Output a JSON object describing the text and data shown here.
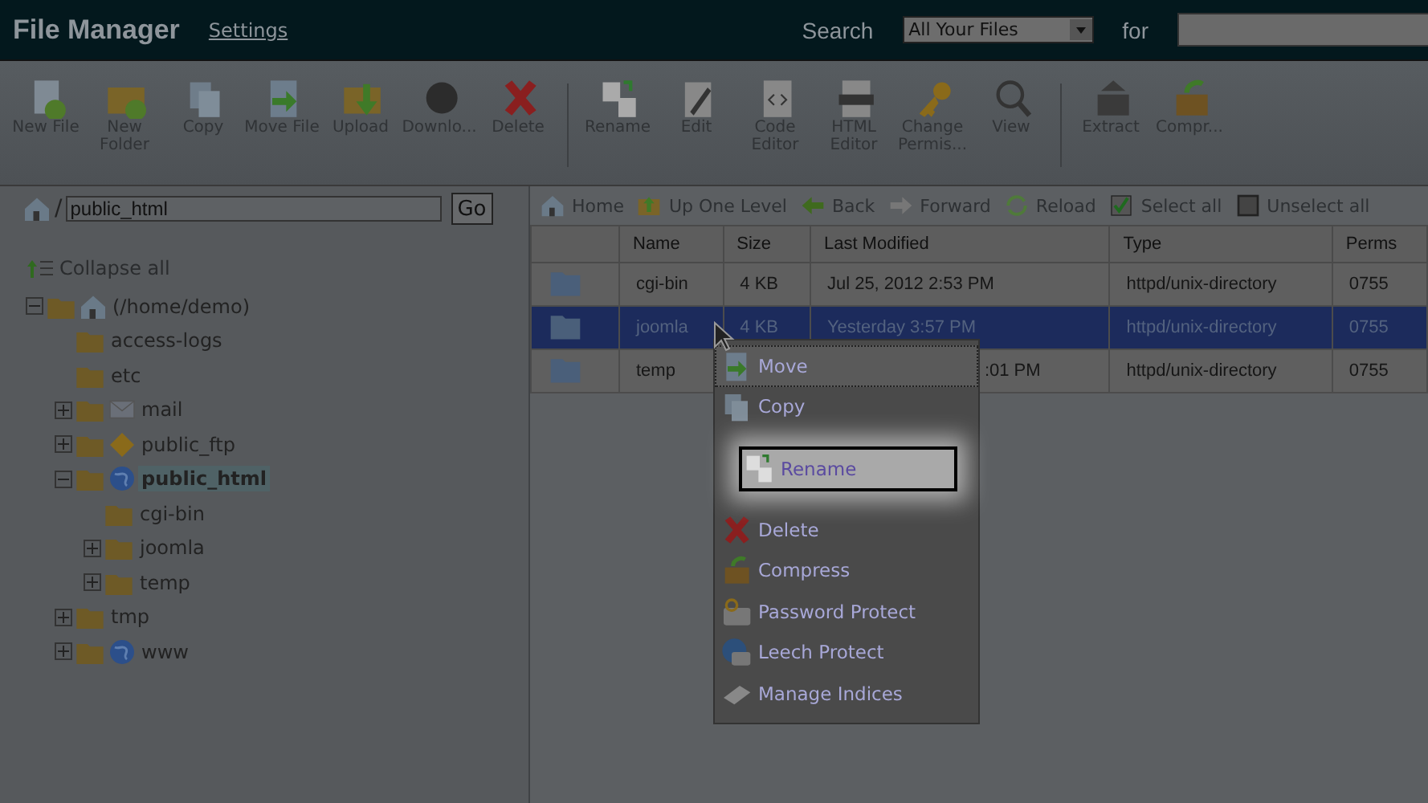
{
  "header": {
    "title": "File Manager",
    "settings_link": "Settings",
    "search_label": "Search",
    "search_scope": "All Your Files",
    "for_label": "for"
  },
  "toolbar": [
    [
      {
        "label": "New File",
        "kind": "newfile"
      },
      {
        "label": "New Folder",
        "kind": "newfolder"
      },
      {
        "label": "Copy",
        "kind": "copy"
      },
      {
        "label": "Move File",
        "kind": "move"
      },
      {
        "label": "Upload",
        "kind": "upload"
      },
      {
        "label": "Downlo...",
        "kind": "download"
      },
      {
        "label": "Delete",
        "kind": "delete"
      }
    ],
    [
      {
        "label": "Rename",
        "kind": "rename"
      },
      {
        "label": "Edit",
        "kind": "edit"
      },
      {
        "label": "Code Editor",
        "kind": "code"
      },
      {
        "label": "HTML Editor",
        "kind": "html"
      },
      {
        "label": "Change Permis...",
        "kind": "key"
      },
      {
        "label": "View",
        "kind": "view"
      }
    ],
    [
      {
        "label": "Extract",
        "kind": "extract"
      },
      {
        "label": "Compr...",
        "kind": "compress"
      }
    ]
  ],
  "path_bar": {
    "prefix": "/",
    "value": "public_html",
    "button": "Go"
  },
  "collapse_all": "Collapse all",
  "tree": [
    {
      "label": "(/home/demo)",
      "kind": "home",
      "expanded": true,
      "selected": false,
      "children": [
        {
          "label": "access-logs",
          "selected": false
        },
        {
          "label": "etc",
          "selected": false
        },
        {
          "label": "mail",
          "kind": "mail",
          "expanded": false,
          "selected": false
        },
        {
          "label": "public_ftp",
          "kind": "ftp",
          "expanded": false,
          "selected": false
        },
        {
          "label": "public_html",
          "kind": "globe",
          "expanded": true,
          "selected": true,
          "children": [
            {
              "label": "cgi-bin",
              "selected": false
            },
            {
              "label": "joomla",
              "expanded": false,
              "selected": false
            },
            {
              "label": "temp",
              "expanded": false,
              "selected": false
            }
          ]
        },
        {
          "label": "tmp",
          "expanded": false,
          "selected": false
        },
        {
          "label": "www",
          "kind": "globe",
          "expanded": false,
          "selected": false
        }
      ]
    }
  ],
  "nav": [
    {
      "label": "Home",
      "kind": "home"
    },
    {
      "label": "Up One Level",
      "kind": "up"
    },
    {
      "label": "Back",
      "kind": "back"
    },
    {
      "label": "Forward",
      "kind": "forward"
    },
    {
      "label": "Reload",
      "kind": "reload"
    },
    {
      "label": "Select all",
      "kind": "check"
    },
    {
      "label": "Unselect all",
      "kind": "uncheck"
    }
  ],
  "table": {
    "columns": [
      "Name",
      "Size",
      "Last Modified",
      "Type",
      "Perms"
    ],
    "rows": [
      {
        "cells": [
          "cgi-bin",
          "4 KB",
          "Jul 25, 2012 2:53 PM",
          "httpd/unix-directory",
          "0755"
        ],
        "selected": false
      },
      {
        "cells": [
          "joomla",
          "4 KB",
          "Yesterday 3:57 PM",
          "httpd/unix-directory",
          "0755"
        ],
        "selected": true
      },
      {
        "cells": [
          "temp",
          "",
          ":01 PM",
          "httpd/unix-directory",
          "0755"
        ],
        "selected": false,
        "partly_covered": true
      }
    ]
  },
  "context_menu": [
    {
      "label": "Move",
      "kind": "move",
      "focused": true
    },
    {
      "label": "Copy",
      "kind": "copy",
      "focused": false
    },
    {
      "label": "Rename",
      "kind": "callout"
    },
    {
      "label": "Delete",
      "kind": "delete",
      "focused": false
    },
    {
      "label": "Compress",
      "kind": "compress",
      "focused": false
    },
    {
      "label": "Password Protect",
      "kind": "lock",
      "focused": false
    },
    {
      "label": "Leech Protect",
      "kind": "leech",
      "focused": false
    },
    {
      "label": "Manage Indices",
      "kind": "indices",
      "focused": false
    }
  ]
}
